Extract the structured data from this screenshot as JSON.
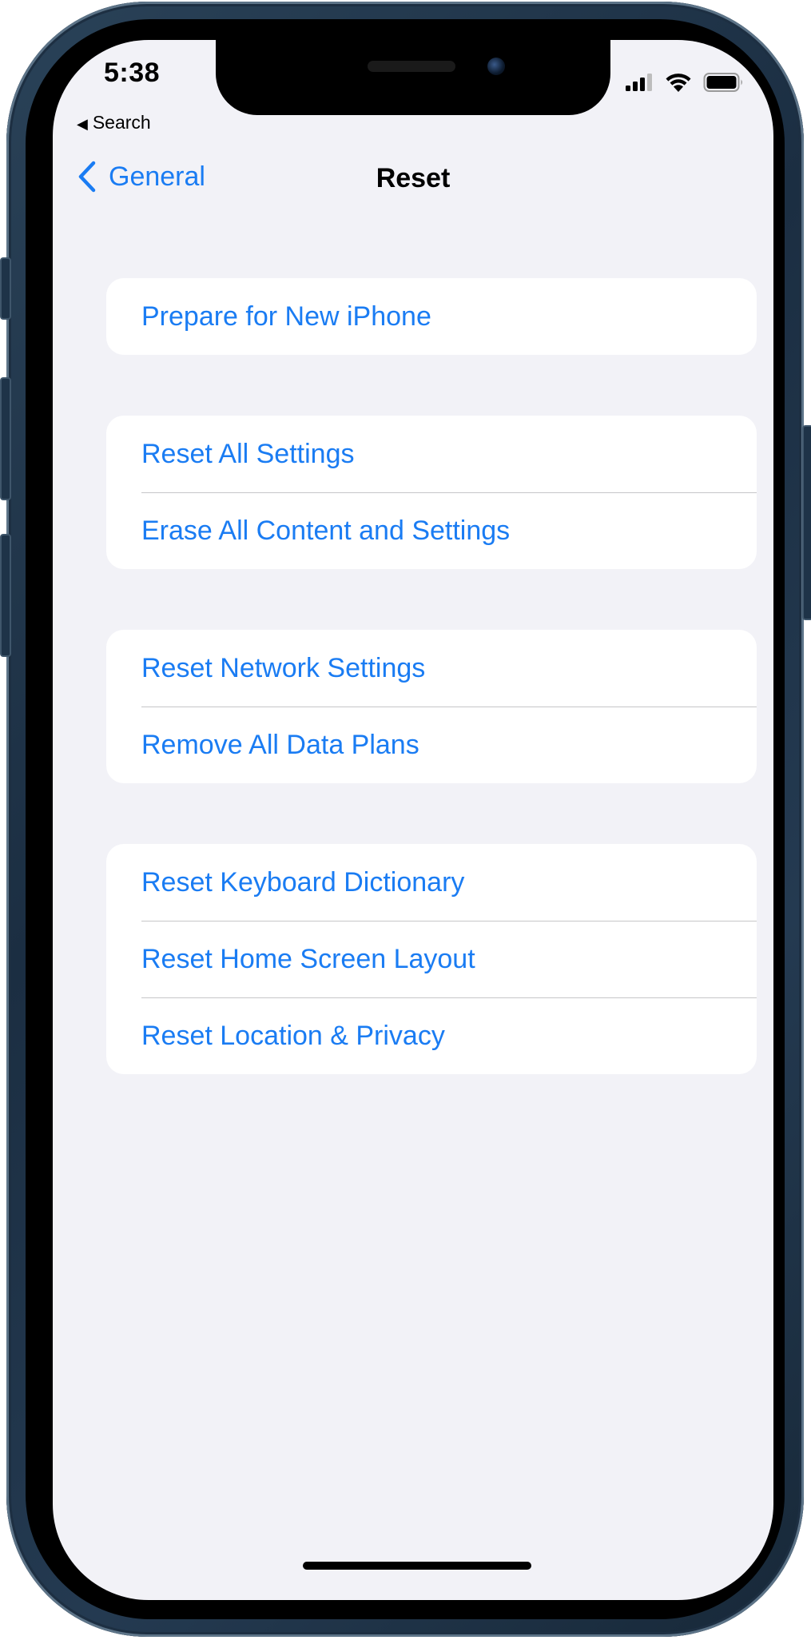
{
  "status_bar": {
    "time": "5:38",
    "back_app": "Search",
    "back_glyph": "◀",
    "icons": [
      "cellular-signal-icon",
      "wifi-icon",
      "battery-icon"
    ]
  },
  "nav": {
    "back_label": "General",
    "title": "Reset"
  },
  "groups": [
    {
      "items": [
        "Prepare for New iPhone"
      ]
    },
    {
      "items": [
        "Reset All Settings",
        "Erase All Content and Settings"
      ]
    },
    {
      "items": [
        "Reset Network Settings",
        "Remove All Data Plans"
      ]
    },
    {
      "items": [
        "Reset Keyboard Dictionary",
        "Reset Home Screen Layout",
        "Reset Location & Privacy"
      ]
    }
  ],
  "colors": {
    "accent": "#1a7cf3",
    "background": "#f2f2f7",
    "cell": "#ffffff",
    "separator": "#c6c6c8",
    "frame": "#1b2e42"
  }
}
